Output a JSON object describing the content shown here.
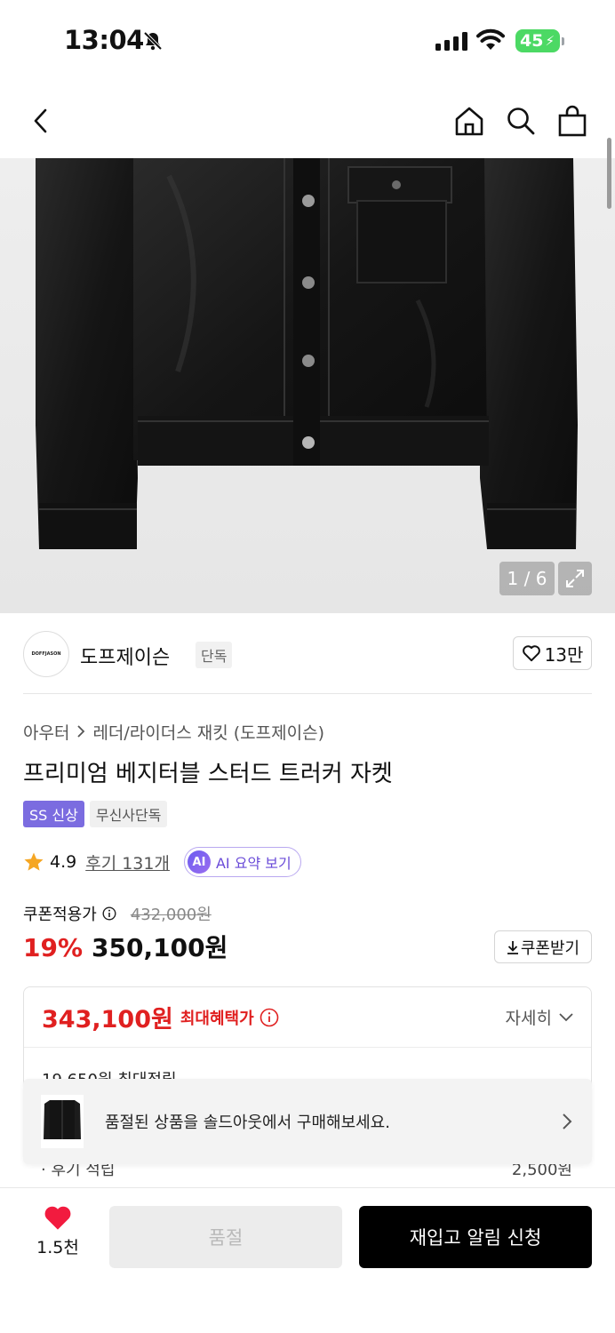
{
  "status": {
    "time": "13:04",
    "battery": "45"
  },
  "nav": {
    "back_icon": "chevron-left-icon",
    "home_icon": "home-icon",
    "search_icon": "search-icon",
    "cart_icon": "shopping-bag-icon"
  },
  "gallery": {
    "counter": "1 / 6",
    "expand_icon": "expand-icon"
  },
  "brand": {
    "logo_text": "DOFFJASON",
    "name": "도프제이슨",
    "tag": "단독",
    "like_count": "13만"
  },
  "product": {
    "breadcrumb": [
      "아우터",
      "레더/라이더스 재킷 (도프제이슨)"
    ],
    "title": "프리미엄 베지터블 스터드 트러커 자켓",
    "badges": [
      "SS 신상",
      "무신사단독"
    ],
    "rating": "4.9",
    "reviews": "후기 131개",
    "ai_badge": "AI",
    "ai_summary": "AI 요약 보기"
  },
  "price": {
    "coupon_label": "쿠폰적용가",
    "original": "432,000원",
    "discount": "19%",
    "final": "350,100원",
    "coupon_button": "쿠폰받기"
  },
  "benefit": {
    "max_price": "343,100원",
    "max_label": "최대혜택가",
    "detail": "자세히",
    "points": "19,650원 최대적립"
  },
  "review_points": {
    "label": "· 후기 적립",
    "value": "2,500원"
  },
  "toast": {
    "message": "품절된 상품을 솔드아웃에서 구매해보세요."
  },
  "bottom": {
    "like_count": "1.5천",
    "soldout": "품절",
    "restock": "재입고 알림 신청"
  },
  "colors": {
    "accent_red": "#e02020",
    "badge_purple": "#7b6ce0",
    "battery_green": "#4cd964"
  }
}
